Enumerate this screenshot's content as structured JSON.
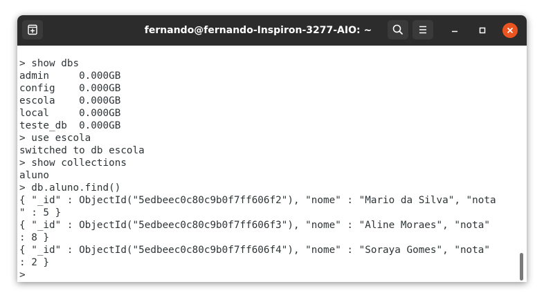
{
  "window": {
    "title": "fernando@fernando-Inspiron-3277-AIO: ~"
  },
  "icons": {
    "new_tab": "new-tab-icon",
    "search": "search-icon",
    "menu": "hamburger-menu-icon",
    "minimize": "minimize-icon",
    "maximize": "maximize-icon",
    "close": "close-icon"
  },
  "colors": {
    "titlebar": "#2c2c2c",
    "close_button": "#e95420",
    "terminal_background": "#ffffff",
    "terminal_text": "#2e3436"
  },
  "terminal": {
    "lines": [
      "> show dbs",
      "admin     0.000GB",
      "config    0.000GB",
      "escola    0.000GB",
      "local     0.000GB",
      "teste_db  0.000GB",
      "> use escola",
      "switched to db escola",
      "> show collections",
      "aluno",
      "> db.aluno.find()",
      "{ \"_id\" : ObjectId(\"5edbeec0c80c9b0f7ff606f2\"), \"nome\" : \"Mario da Silva\", \"nota",
      "\" : 5 }",
      "{ \"_id\" : ObjectId(\"5edbeec0c80c9b0f7ff606f3\"), \"nome\" : \"Aline Moraes\", \"nota\"",
      ": 8 }",
      "{ \"_id\" : ObjectId(\"5edbeec0c80c9b0f7ff606f4\"), \"nome\" : \"Soraya Gomes\", \"nota\"",
      ": 2 }",
      ">"
    ]
  }
}
